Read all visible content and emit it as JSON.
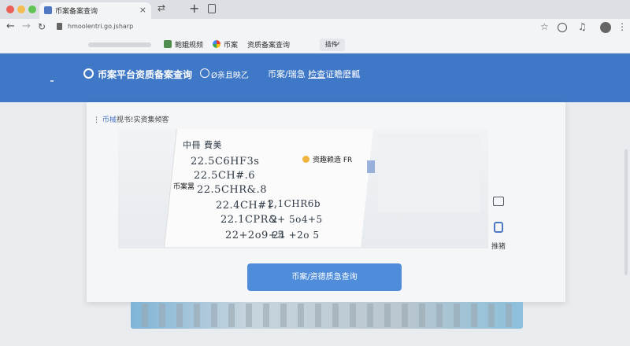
{
  "browser": {
    "tab_title": "币案备案查询",
    "tab_close": "×",
    "tab_extra": "⇄",
    "new_tab": "+",
    "url": "hmoolentri.go.jsharp",
    "bookmarks": [
      {
        "label": "鲍娥规频"
      },
      {
        "label": "币案"
      },
      {
        "label": "资质备案查询"
      }
    ],
    "bookmark_more": "插件·",
    "bookmark_check": "✓"
  },
  "header": {
    "title": "币案平台资质备案查询",
    "badge_text": "Ø亲且映乙",
    "links_pre": "币案/瑞急 ",
    "links_underlined": "检查",
    "links_post": "证瞻麽瓤"
  },
  "main": {
    "breadcrumb_prefix": "⋮ ",
    "breadcrumb_link": "币械",
    "breadcrumb_rest": "视书!实资集倾客",
    "photo_label_primary": "资趣赖造 FR",
    "photo_label_left": "币案暠",
    "handwriting": [
      "中冊 費美",
      "22.5C6HF3s",
      "22.5CH#.6",
      "22.5CHR&.8",
      "22.4CH#1.",
      "22.1CPR&",
      "22+2o9+5",
      "2.1CHR6b",
      "2+ 5o4+5",
      "24 +2o 5"
    ],
    "side_tool_label": "推猪",
    "cta_label": "币案/资德质急查询"
  },
  "colors": {
    "header_bg": "#3f78c6",
    "cta_bg": "#4f8ddb",
    "accent": "#4f78c4"
  }
}
